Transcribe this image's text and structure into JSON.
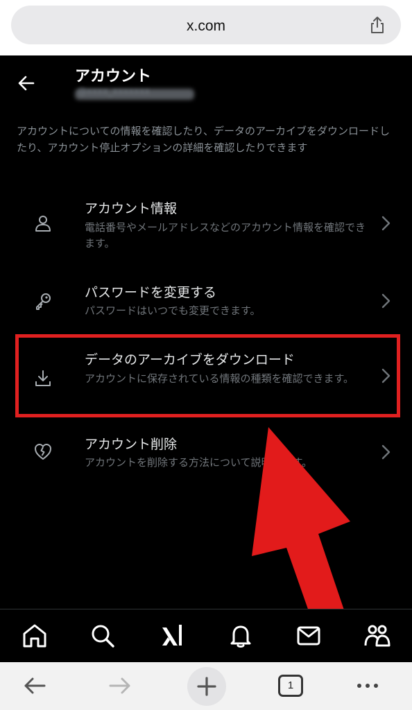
{
  "browser": {
    "url": "x.com",
    "tab_count": "1"
  },
  "header": {
    "title": "アカウント",
    "handle": "@xxxx_xxxxxxx",
    "description": "アカウントについての情報を確認したり、データのアーカイブをダウンロードしたり、アカウント停止オプションの詳細を確認したりできます"
  },
  "items": [
    {
      "title": "アカウント情報",
      "subtitle": "電話番号やメールアドレスなどのアカウント情報を確認できます。",
      "icon": "person-icon"
    },
    {
      "title": "パスワードを変更する",
      "subtitle": "パスワードはいつでも変更できます。",
      "icon": "key-icon"
    },
    {
      "title": "データのアーカイブをダウンロード",
      "subtitle": "アカウントに保存されている情報の種類を確認できます。",
      "icon": "download-icon"
    },
    {
      "title": "アカウント削除",
      "subtitle": "アカウントを削除する方法について説明します。",
      "icon": "broken-heart-icon"
    }
  ],
  "bottom_nav": [
    "home-icon",
    "search-icon",
    "grok-icon",
    "bell-icon",
    "mail-icon",
    "communities-icon"
  ],
  "colors": {
    "background": "#000000",
    "highlight": "#e02020",
    "text_primary": "#e7e9ea",
    "text_secondary": "#71767b"
  }
}
